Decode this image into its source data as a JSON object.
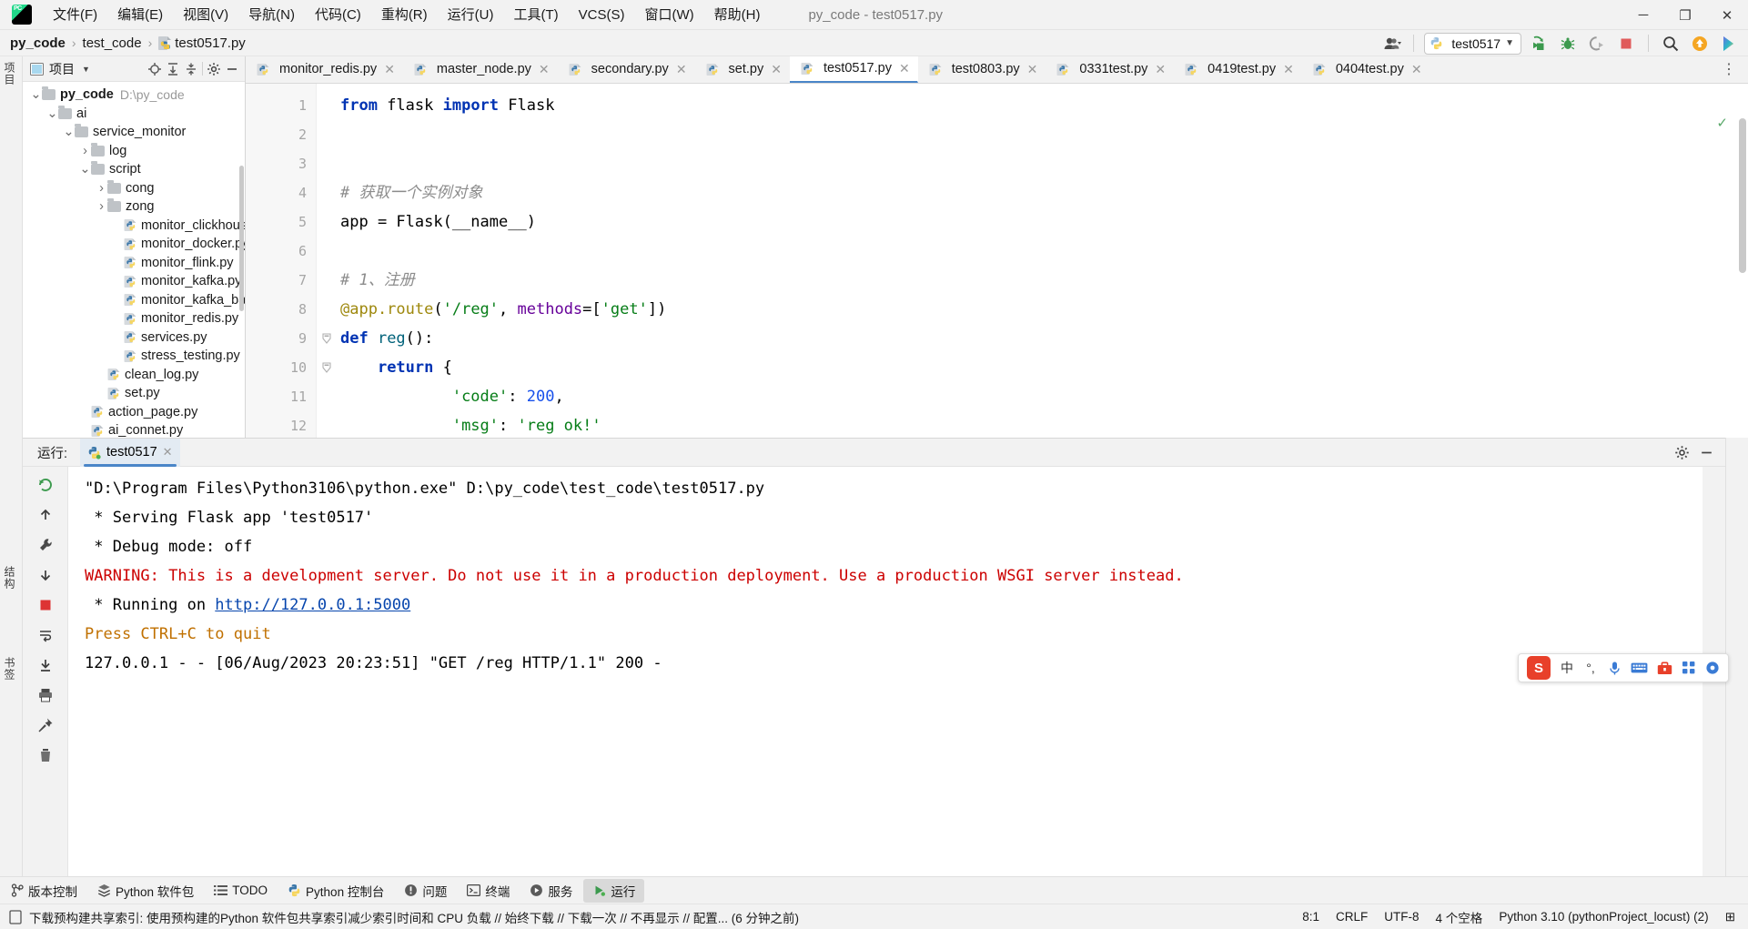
{
  "titlebar": {
    "logo_text": "PC",
    "window_title": "py_code - test0517.py",
    "menus": [
      {
        "label": "文件(F)",
        "mnemonic": "F"
      },
      {
        "label": "编辑(E)",
        "mnemonic": "E"
      },
      {
        "label": "视图(V)",
        "mnemonic": "V"
      },
      {
        "label": "导航(N)",
        "mnemonic": "N"
      },
      {
        "label": "代码(C)",
        "mnemonic": "C"
      },
      {
        "label": "重构(R)",
        "mnemonic": "R"
      },
      {
        "label": "运行(U)",
        "mnemonic": "U"
      },
      {
        "label": "工具(T)",
        "mnemonic": "T"
      },
      {
        "label": "VCS(S)",
        "mnemonic": "S"
      },
      {
        "label": "窗口(W)",
        "mnemonic": "W"
      },
      {
        "label": "帮助(H)",
        "mnemonic": "H"
      }
    ],
    "window_controls": {
      "minimize": "─",
      "maximize": "❐",
      "close": "✕"
    }
  },
  "navbar": {
    "breadcrumbs": [
      "py_code",
      "test_code",
      "test0517.py"
    ],
    "separator": "›",
    "run_config": "test0517",
    "dropdown_caret": "▼",
    "icons": [
      "people-icon",
      "run-icon",
      "debug-icon",
      "coverage-icon",
      "stop-icon",
      "search-icon",
      "update-icon",
      "ai-icon"
    ]
  },
  "project_panel": {
    "title": "项目",
    "caret": "▼",
    "header_icons": [
      "locate-icon",
      "expand-all-icon",
      "collapse-all-icon",
      "gear-icon",
      "minimize-icon"
    ],
    "tree": [
      {
        "label": "py_code",
        "path": "D:\\py_code",
        "depth": 0,
        "type": "folder",
        "expanded": true,
        "bold": true
      },
      {
        "label": "ai",
        "depth": 1,
        "type": "folder",
        "expanded": true
      },
      {
        "label": "service_monitor",
        "depth": 2,
        "type": "folder",
        "expanded": true
      },
      {
        "label": "log",
        "depth": 3,
        "type": "folder",
        "expanded": false
      },
      {
        "label": "script",
        "depth": 3,
        "type": "folder",
        "expanded": true
      },
      {
        "label": "cong",
        "depth": 4,
        "type": "folder",
        "expanded": false
      },
      {
        "label": "zong",
        "depth": 4,
        "type": "folder",
        "expanded": false
      },
      {
        "label": "monitor_clickhouse.py",
        "depth": 5,
        "type": "python"
      },
      {
        "label": "monitor_docker.py",
        "depth": 5,
        "type": "python"
      },
      {
        "label": "monitor_flink.py",
        "depth": 5,
        "type": "python"
      },
      {
        "label": "monitor_kafka.py",
        "depth": 5,
        "type": "python"
      },
      {
        "label": "monitor_kafka_backup.py",
        "depth": 5,
        "type": "python"
      },
      {
        "label": "monitor_redis.py",
        "depth": 5,
        "type": "python"
      },
      {
        "label": "services.py",
        "depth": 5,
        "type": "python"
      },
      {
        "label": "stress_testing.py",
        "depth": 5,
        "type": "python"
      },
      {
        "label": "clean_log.py",
        "depth": 4,
        "type": "python"
      },
      {
        "label": "set.py",
        "depth": 4,
        "type": "python"
      },
      {
        "label": "action_page.py",
        "depth": 3,
        "type": "python"
      },
      {
        "label": "ai_connet.py",
        "depth": 3,
        "type": "python"
      }
    ]
  },
  "editor": {
    "tabs": [
      {
        "label": "monitor_redis.py",
        "active": false
      },
      {
        "label": "master_node.py",
        "active": false
      },
      {
        "label": "secondary.py",
        "active": false
      },
      {
        "label": "set.py",
        "active": false
      },
      {
        "label": "test0517.py",
        "active": true
      },
      {
        "label": "test0803.py",
        "active": false
      },
      {
        "label": "0331test.py",
        "active": false
      },
      {
        "label": "0419test.py",
        "active": false
      },
      {
        "label": "0404test.py",
        "active": false
      }
    ],
    "tab_close_glyph": "✕",
    "more_tabs_glyph": "⋮",
    "inspection_ok_glyph": "✓",
    "line_numbers": [
      "1",
      "2",
      "3",
      "4",
      "5",
      "6",
      "7",
      "8",
      "9",
      "10",
      "11",
      "12"
    ],
    "code_lines": [
      {
        "n": 1,
        "tokens": [
          {
            "t": "from ",
            "c": "kw"
          },
          {
            "t": "flask ",
            "c": "plain"
          },
          {
            "t": "import ",
            "c": "kw"
          },
          {
            "t": "Flask",
            "c": "plain"
          }
        ]
      },
      {
        "n": 2,
        "tokens": []
      },
      {
        "n": 3,
        "tokens": []
      },
      {
        "n": 4,
        "tokens": [
          {
            "t": "# 获取一个实例对象",
            "c": "cm"
          }
        ]
      },
      {
        "n": 5,
        "tokens": [
          {
            "t": "app = Flask(__name__)",
            "c": "plain"
          }
        ]
      },
      {
        "n": 6,
        "tokens": []
      },
      {
        "n": 7,
        "tokens": [
          {
            "t": "# 1、注册",
            "c": "cm"
          }
        ]
      },
      {
        "n": 8,
        "tokens": [
          {
            "t": "@app.route",
            "c": "dec"
          },
          {
            "t": "(",
            "c": "plain"
          },
          {
            "t": "'/reg'",
            "c": "st"
          },
          {
            "t": ", ",
            "c": "plain"
          },
          {
            "t": "methods",
            "c": "kwa"
          },
          {
            "t": "=[",
            "c": "plain"
          },
          {
            "t": "'get'",
            "c": "st"
          },
          {
            "t": "])",
            "c": "plain"
          }
        ]
      },
      {
        "n": 9,
        "tokens": [
          {
            "t": "def ",
            "c": "kw"
          },
          {
            "t": "reg",
            "c": "fn"
          },
          {
            "t": "():",
            "c": "plain"
          }
        ],
        "fold": true
      },
      {
        "n": 10,
        "tokens": [
          {
            "t": "    ",
            "c": "plain"
          },
          {
            "t": "return ",
            "c": "kw"
          },
          {
            "t": "{",
            "c": "plain"
          }
        ],
        "fold": true
      },
      {
        "n": 11,
        "tokens": [
          {
            "t": "            ",
            "c": "plain"
          },
          {
            "t": "'code'",
            "c": "st"
          },
          {
            "t": ": ",
            "c": "plain"
          },
          {
            "t": "200",
            "c": "num"
          },
          {
            "t": ",",
            "c": "plain"
          }
        ]
      },
      {
        "n": 12,
        "tokens": [
          {
            "t": "            ",
            "c": "plain"
          },
          {
            "t": "'msg'",
            "c": "st"
          },
          {
            "t": ": ",
            "c": "plain"
          },
          {
            "t": "'reg ok!'",
            "c": "st"
          }
        ]
      }
    ]
  },
  "run_panel": {
    "label": "运行:",
    "tab_label": "test0517",
    "tab_close_glyph": "✕",
    "header_icons": [
      "gear-icon",
      "minimize-icon"
    ],
    "toolbar_icons": [
      "rerun-icon",
      "scroll-up-icon",
      "wrench-icon",
      "scroll-down-icon",
      "stop-icon",
      "soft-wrap-icon",
      "scroll-end-icon",
      "print-icon",
      "pin-icon",
      "trash-icon"
    ],
    "console_lines": [
      {
        "text": "\"D:\\Program Files\\Python3106\\python.exe\" D:\\py_code\\test_code\\test0517.py",
        "style": "cmd"
      },
      {
        "text": " * Serving Flask app 'test0517'",
        "style": "info"
      },
      {
        "text": " * Debug mode: off",
        "style": "info"
      },
      {
        "text": "WARNING: This is a development server. Do not use it in a production deployment. Use a production WSGI server instead.",
        "style": "warn"
      },
      {
        "text": " * Running on ",
        "style": "info",
        "link": "http://127.0.0.1:5000"
      },
      {
        "text": "Press CTRL+C to quit",
        "style": "press"
      },
      {
        "text": "127.0.0.1 - - [06/Aug/2023 20:23:51] \"GET /reg HTTP/1.1\" 200 -",
        "style": "info"
      }
    ]
  },
  "ime": {
    "logo": "S",
    "items": [
      "中",
      "°,",
      "mic-icon",
      "keyboard-icon",
      "toolbox-icon",
      "apps-icon",
      "settings-icon"
    ]
  },
  "bottombar": {
    "items": [
      {
        "label": "版本控制",
        "icon": "branch-icon",
        "active": false
      },
      {
        "label": "Python 软件包",
        "icon": "packages-icon",
        "active": false
      },
      {
        "label": "TODO",
        "icon": "todo-icon",
        "active": false
      },
      {
        "label": "Python 控制台",
        "icon": "python-icon",
        "active": false
      },
      {
        "label": "问题",
        "icon": "problems-icon",
        "active": false
      },
      {
        "label": "终端",
        "icon": "terminal-icon",
        "active": false
      },
      {
        "label": "服务",
        "icon": "services-icon",
        "active": false
      },
      {
        "label": "运行",
        "icon": "run-icon",
        "active": true
      }
    ]
  },
  "statusbar": {
    "message": "下载预构建共享索引: 使用预构建的Python 软件包共享索引减少索引时间和 CPU 负载 // 始终下载 // 下载一次 // 不再显示 // 配置... (6 分钟之前)",
    "caret_position": "8:1",
    "line_separator": "CRLF",
    "encoding": "UTF-8",
    "indent": "4 个空格",
    "interpreter": "Python 3.10 (pythonProject_locust) (2)",
    "lock_glyph": "⊞"
  },
  "left_strip": {
    "labels": [
      "项目",
      "结构",
      "书签"
    ]
  },
  "colors": {
    "accent": "#4a86c8",
    "warn": "#cc0000",
    "link": "#0645ad",
    "string": "#067d17",
    "keyword": "#0033b3",
    "comment": "#8c8c8c",
    "number": "#1750eb",
    "decorator": "#9e880d",
    "function": "#00627a",
    "kwarg": "#660099",
    "green_run": "#59a869",
    "ime_red": "#e8402a"
  }
}
